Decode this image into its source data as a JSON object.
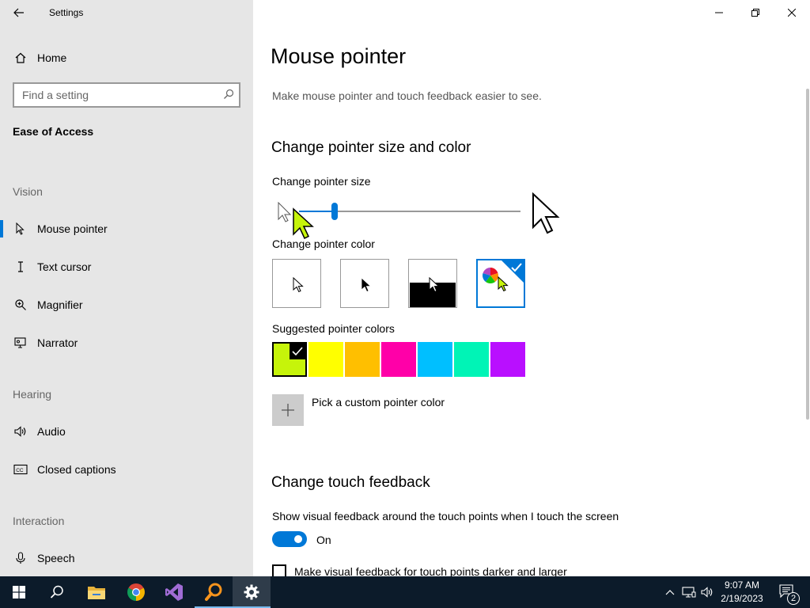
{
  "window": {
    "title": "Settings"
  },
  "sidebar": {
    "home": "Home",
    "search_placeholder": "Find a setting",
    "current_section": "Ease of Access",
    "groups": {
      "vision": "Vision",
      "hearing": "Hearing",
      "interaction": "Interaction"
    },
    "items": {
      "mouse_pointer": "Mouse pointer",
      "text_cursor": "Text cursor",
      "magnifier": "Magnifier",
      "narrator": "Narrator",
      "audio": "Audio",
      "closed_captions": "Closed captions",
      "speech": "Speech"
    },
    "selected": "Mouse pointer"
  },
  "main": {
    "title": "Mouse pointer",
    "description": "Make mouse pointer and touch feedback easier to see.",
    "size_color": {
      "heading": "Change pointer size and color",
      "size_label": "Change pointer size",
      "size_value": 0.16,
      "color_label": "Change pointer color",
      "color_options": [
        "white",
        "black",
        "inverted",
        "custom"
      ],
      "selected_color_option": "custom",
      "suggested_label": "Suggested pointer colors",
      "suggested_colors": [
        "#c6f40a",
        "#ffff00",
        "#ffbf00",
        "#ff00a8",
        "#00bfff",
        "#00f4b6",
        "#b90fff"
      ],
      "selected_suggested": "#c6f40a",
      "custom_label": "Pick a custom pointer color"
    },
    "touch": {
      "heading": "Change touch feedback",
      "show_label": "Show visual feedback around the touch points when I touch the screen",
      "toggle_state": "On",
      "darker_label": "Make visual feedback for touch points darker and larger",
      "darker_checked": false
    }
  },
  "taskbar": {
    "apps": [
      "start-icon",
      "search-icon",
      "file-explorer-icon",
      "chrome-icon",
      "visual-studio-icon",
      "search-app-icon",
      "settings-icon"
    ],
    "active_app": "settings-icon",
    "time": "9:07 AM",
    "date": "2/19/2023",
    "notification_count": "2"
  }
}
